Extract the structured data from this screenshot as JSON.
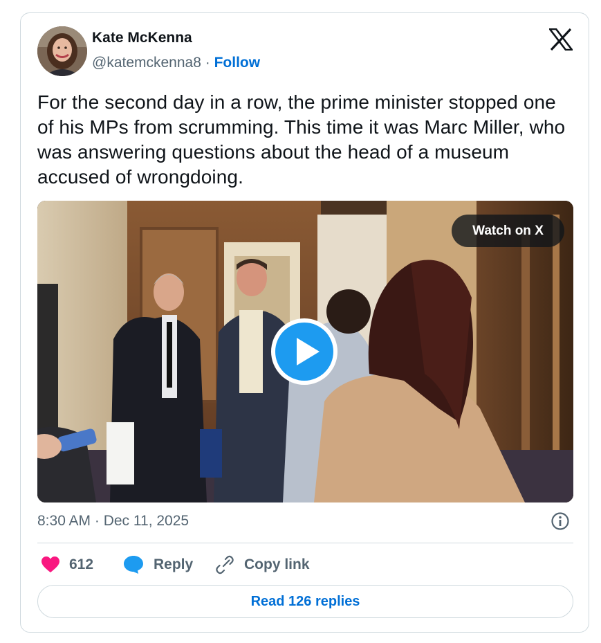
{
  "author": {
    "name": "Kate McKenna",
    "handle": "@katemckenna8",
    "separator": " · ",
    "follow_label": "Follow"
  },
  "tweet": {
    "text": "For the second day in a row, the prime minister stopped one of his MPs from scrumming. This time it was Marc Miller, who was answering questions about the head of a museum accused of wrongdoing.",
    "timestamp": "8:30 AM · Dec 11, 2025"
  },
  "media": {
    "type": "video",
    "watch_label": "Watch on X"
  },
  "actions": {
    "like_count": "612",
    "reply_label": "Reply",
    "copy_link_label": "Copy link"
  },
  "replies_button_label": "Read 126 replies",
  "colors": {
    "accent": "#006fd6",
    "like": "#f91880",
    "reply": "#1d9bf0",
    "muted_text": "#536471",
    "border": "#cfd9de",
    "play_button": "#1d9bf0"
  },
  "icons": {
    "brand": "x-logo-icon",
    "play": "play-icon",
    "info": "info-icon",
    "like": "heart-icon",
    "reply": "speech-bubble-icon",
    "copy_link": "link-icon"
  }
}
